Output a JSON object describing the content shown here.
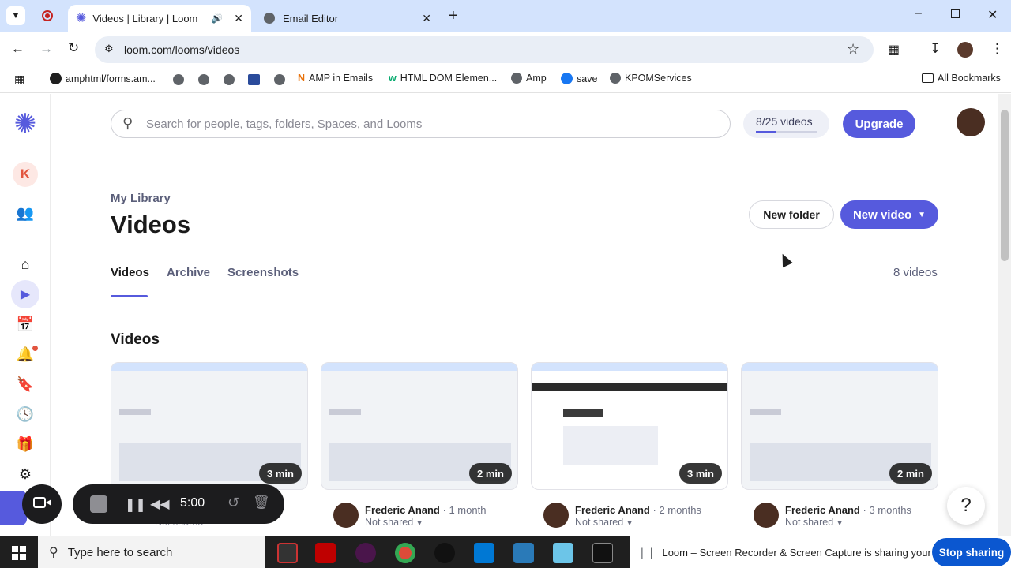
{
  "browser": {
    "tabs": [
      {
        "title": "Videos | Library | Loom",
        "active": true
      },
      {
        "title": "Email Editor",
        "active": false
      }
    ],
    "url": "loom.com/looms/videos",
    "bookmarks": [
      {
        "label": "amphtml/forms.am...",
        "icon": "github-icon"
      },
      {
        "label": "AMP in Emails",
        "icon": "amp-icon"
      },
      {
        "label": "HTML DOM Elemen...",
        "icon": "w3schools-icon"
      },
      {
        "label": "Amp",
        "icon": "globe-icon"
      },
      {
        "label": "save",
        "icon": "facebook-icon"
      },
      {
        "label": "KPOMServices",
        "icon": "globe-icon"
      }
    ],
    "all_bookmarks": "All Bookmarks"
  },
  "app": {
    "search_placeholder": "Search for people, tags, folders, Spaces, and Looms",
    "quota": "8/25 videos",
    "upgrade": "Upgrade",
    "workspace_initial": "K",
    "breadcrumb": "My Library",
    "page_title": "Videos",
    "new_folder": "New folder",
    "new_video": "New video",
    "tabs": [
      "Videos",
      "Archive",
      "Screenshots"
    ],
    "video_count": "8 videos",
    "section_title": "Videos",
    "cards": [
      {
        "duration": "3 min",
        "author": "",
        "age": "",
        "shared": "Not shared"
      },
      {
        "duration": "2 min",
        "author": "Frederic Anand",
        "age": "1 month",
        "shared": "Not shared"
      },
      {
        "duration": "3 min",
        "author": "Frederic Anand",
        "age": "2 months",
        "shared": "Not shared"
      },
      {
        "duration": "2 min",
        "author": "Frederic Anand",
        "age": "3 months",
        "shared": "Not shared"
      }
    ],
    "help": "?",
    "accent": "#565add"
  },
  "recorder": {
    "timer": "5:00"
  },
  "taskbar": {
    "search_placeholder": "Type here to search",
    "share_notice": "Loom – Screen Recorder & Screen Capture is sharing your screen.",
    "stop_sharing": "Stop sharing"
  }
}
